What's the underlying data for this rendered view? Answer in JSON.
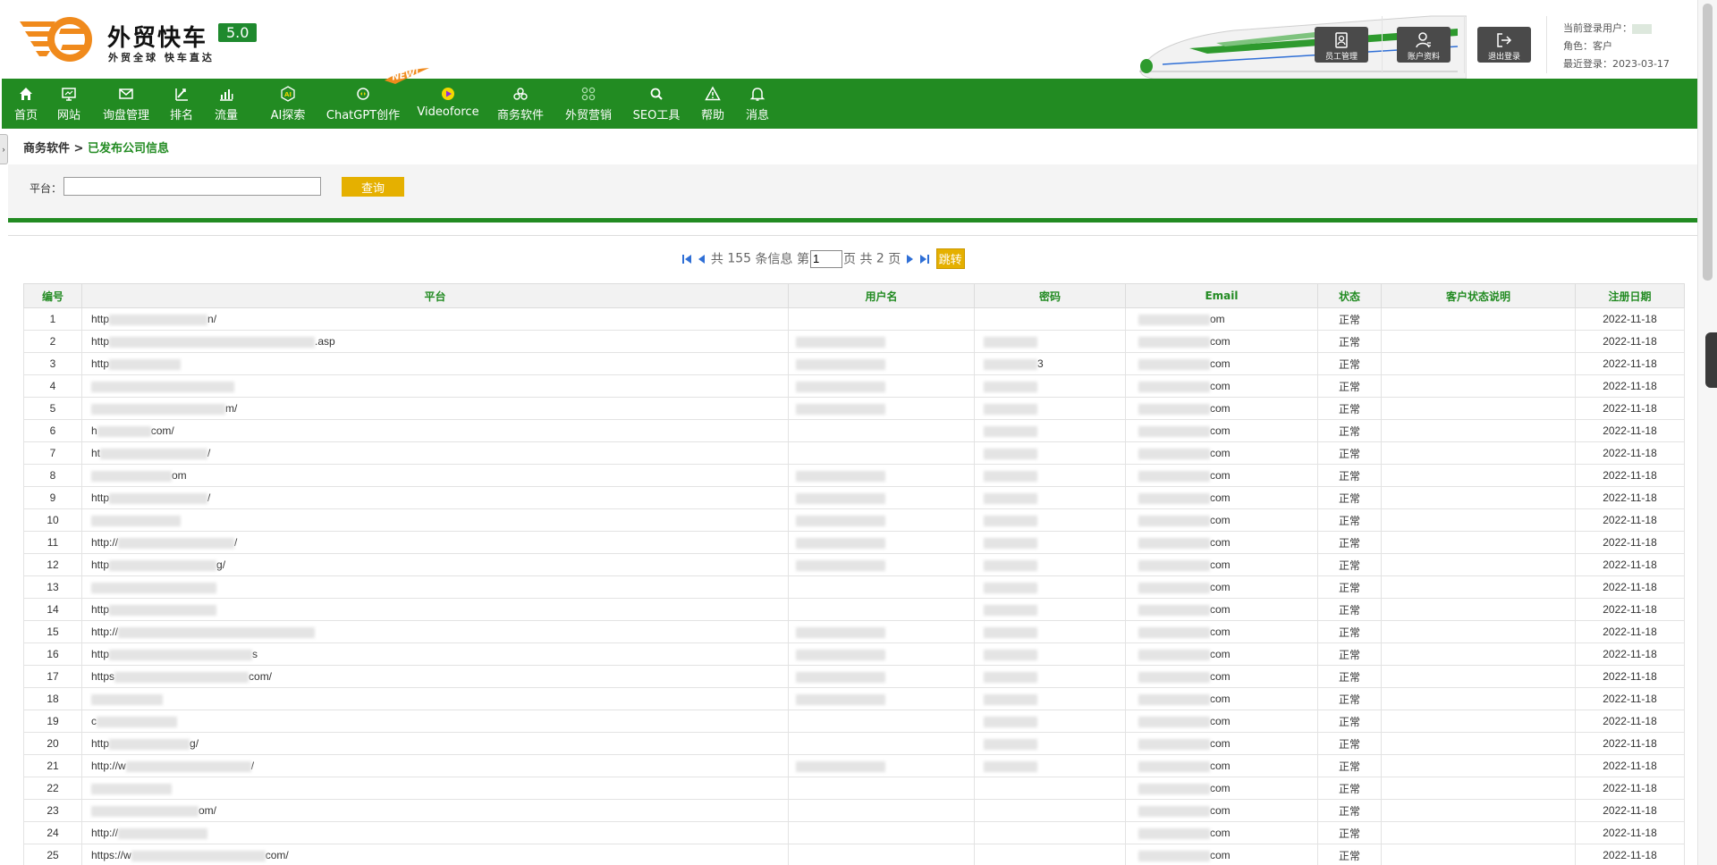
{
  "logo": {
    "title": "外贸快车",
    "version": "5.0",
    "slogan": "外贸全球 快车直达"
  },
  "header": {
    "buttons": [
      {
        "label": "员工管理",
        "icon": "employee-icon"
      },
      {
        "label": "账户资料",
        "icon": "account-icon"
      },
      {
        "label": "退出登录",
        "icon": "logout-icon"
      }
    ],
    "user": {
      "current_user_label": "当前登录用户：",
      "role_label": "角色：",
      "role": "客户",
      "last_login_label": "最近登录：",
      "last_login": "2023-03-17"
    }
  },
  "nav": {
    "items": [
      {
        "label": "首页",
        "icon": "home-icon"
      },
      {
        "label": "网站",
        "icon": "website-icon"
      },
      {
        "label": "询盘管理",
        "icon": "mail-icon"
      },
      {
        "label": "排名",
        "icon": "ranking-icon"
      },
      {
        "label": "流量",
        "icon": "traffic-icon"
      },
      {
        "label": "AI探索",
        "icon": "ai-icon"
      },
      {
        "label": "ChatGPT创作",
        "icon": "chatgpt-icon"
      },
      {
        "label": "Videoforce",
        "icon": "video-icon"
      },
      {
        "label": "商务软件",
        "icon": "business-icon"
      },
      {
        "label": "外贸营销",
        "icon": "marketing-icon"
      },
      {
        "label": "SEO工具",
        "icon": "seo-search-icon"
      },
      {
        "label": "帮助",
        "icon": "help-icon"
      },
      {
        "label": "消息",
        "icon": "bell-icon"
      }
    ],
    "new_badge": "NEW!"
  },
  "sidebar_toggle": "›",
  "breadcrumb": {
    "parent": "商务软件",
    "separator": " > ",
    "current": "已发布公司信息"
  },
  "search": {
    "label": "平台：",
    "value": "",
    "button": "查询"
  },
  "pager": {
    "prefix": "共",
    "total": "155",
    "mid1": "条信息 第",
    "page": "1",
    "mid2": "页 共",
    "pages": "2",
    "suffix": "页",
    "go_label": "跳转"
  },
  "table": {
    "columns": [
      "编号",
      "平台",
      "用户名",
      "密码",
      "Email",
      "状态",
      "客户状态说明",
      "注册日期"
    ],
    "rows": [
      {
        "no": "1",
        "platform": "http",
        "platform_tail": "n/",
        "user": false,
        "pass": false,
        "email_tail": "om",
        "status": "正常",
        "date": "2022-11-18"
      },
      {
        "no": "2",
        "platform": "http",
        "platform_tail": ".asp",
        "user": true,
        "pass": true,
        "email_tail": "com",
        "status": "正常",
        "date": "2022-11-18"
      },
      {
        "no": "3",
        "platform": "http",
        "platform_tail": "",
        "user": true,
        "pass": true,
        "pass_tail": "3",
        "email_tail": "com",
        "status": "正常",
        "date": "2022-11-18"
      },
      {
        "no": "4",
        "platform": "",
        "platform_tail": "",
        "user": true,
        "pass": true,
        "email_tail": "com",
        "status": "正常",
        "date": "2022-11-18"
      },
      {
        "no": "5",
        "platform": "",
        "platform_tail": "m/",
        "user": true,
        "pass": true,
        "email_tail": "com",
        "status": "正常",
        "date": "2022-11-18"
      },
      {
        "no": "6",
        "platform": "h",
        "platform_tail": "com/",
        "user": false,
        "pass": true,
        "email_tail": "com",
        "status": "正常",
        "date": "2022-11-18"
      },
      {
        "no": "7",
        "platform": "ht",
        "platform_tail": "/",
        "user": false,
        "pass": true,
        "email_tail": "com",
        "status": "正常",
        "date": "2022-11-18"
      },
      {
        "no": "8",
        "platform": "",
        "platform_tail": "om",
        "user": true,
        "pass": true,
        "email_tail": "com",
        "status": "正常",
        "date": "2022-11-18"
      },
      {
        "no": "9",
        "platform": "http",
        "platform_tail": "/",
        "user": true,
        "pass": true,
        "email_tail": "com",
        "status": "正常",
        "date": "2022-11-18"
      },
      {
        "no": "10",
        "platform": "",
        "platform_tail": "",
        "user": true,
        "pass": true,
        "email_tail": "com",
        "status": "正常",
        "date": "2022-11-18"
      },
      {
        "no": "11",
        "platform": "http://",
        "platform_tail": "/",
        "user": true,
        "pass": true,
        "email_tail": "com",
        "status": "正常",
        "date": "2022-11-18"
      },
      {
        "no": "12",
        "platform": "http",
        "platform_tail": "g/",
        "user": true,
        "pass": true,
        "email_tail": "com",
        "status": "正常",
        "date": "2022-11-18"
      },
      {
        "no": "13",
        "platform": "",
        "platform_tail": "",
        "user": false,
        "pass": true,
        "email_tail": "com",
        "status": "正常",
        "date": "2022-11-18"
      },
      {
        "no": "14",
        "platform": "http",
        "platform_tail": "",
        "user": false,
        "pass": true,
        "email_tail": "com",
        "status": "正常",
        "date": "2022-11-18"
      },
      {
        "no": "15",
        "platform": "http://",
        "platform_tail": "",
        "user": true,
        "pass": true,
        "email_tail": "com",
        "status": "正常",
        "date": "2022-11-18"
      },
      {
        "no": "16",
        "platform": "http",
        "platform_tail": "s",
        "user": true,
        "pass": true,
        "email_tail": "com",
        "status": "正常",
        "date": "2022-11-18"
      },
      {
        "no": "17",
        "platform": "https",
        "platform_tail": "com/",
        "user": true,
        "pass": true,
        "email_tail": "com",
        "status": "正常",
        "date": "2022-11-18"
      },
      {
        "no": "18",
        "platform": "",
        "platform_tail": "",
        "user": true,
        "pass": true,
        "email_tail": "com",
        "status": "正常",
        "date": "2022-11-18"
      },
      {
        "no": "19",
        "platform": "c",
        "platform_tail": "",
        "user": false,
        "pass": true,
        "email_tail": "com",
        "status": "正常",
        "date": "2022-11-18"
      },
      {
        "no": "20",
        "platform": "http",
        "platform_tail": "g/",
        "user": false,
        "pass": true,
        "email_tail": "com",
        "status": "正常",
        "date": "2022-11-18"
      },
      {
        "no": "21",
        "platform": "http://w",
        "platform_tail": "/",
        "user": true,
        "pass": true,
        "email_tail": "com",
        "status": "正常",
        "date": "2022-11-18"
      },
      {
        "no": "22",
        "platform": "",
        "platform_tail": "",
        "user": false,
        "pass": false,
        "email_tail": "com",
        "status": "正常",
        "date": "2022-11-18"
      },
      {
        "no": "23",
        "platform": "",
        "platform_tail": "om/",
        "user": false,
        "pass": false,
        "email_tail": "com",
        "status": "正常",
        "date": "2022-11-18"
      },
      {
        "no": "24",
        "platform": "http://",
        "platform_tail": "",
        "user": false,
        "pass": false,
        "email_tail": "com",
        "status": "正常",
        "date": "2022-11-18"
      },
      {
        "no": "25",
        "platform": "https://w",
        "platform_tail": "com/",
        "user": false,
        "pass": false,
        "email_tail": "com",
        "status": "正常",
        "date": "2022-11-18"
      }
    ]
  },
  "colors": {
    "brand_green": "#228b22",
    "accent_gold": "#e5b000",
    "logo_orange": "#f08a1c"
  }
}
